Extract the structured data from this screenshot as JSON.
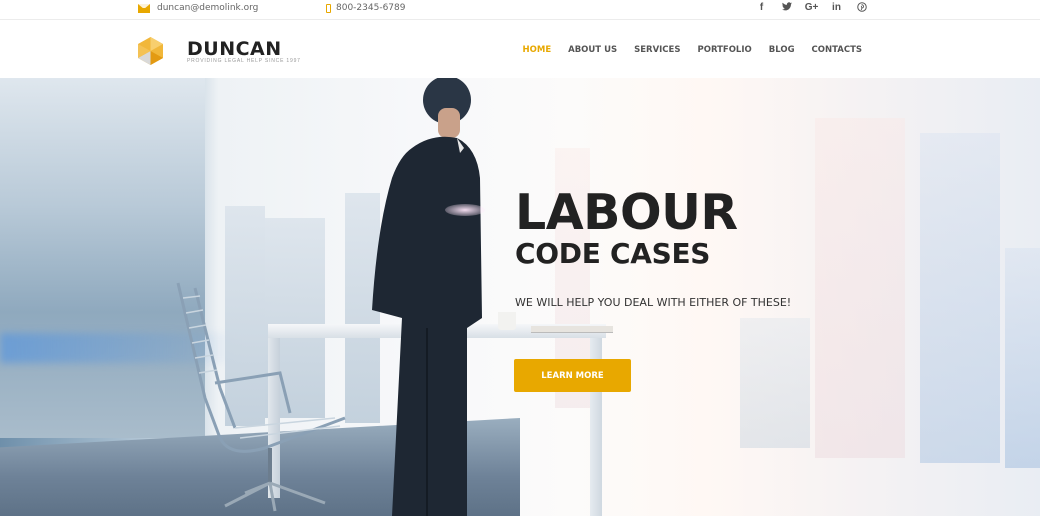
{
  "topbar": {
    "email": "duncan@demolink.org",
    "phone": "800-2345-6789",
    "social": [
      {
        "name": "facebook",
        "glyph": "f"
      },
      {
        "name": "twitter",
        "glyph": "t"
      },
      {
        "name": "google-plus",
        "glyph": "G+"
      },
      {
        "name": "linkedin",
        "glyph": "in"
      },
      {
        "name": "pinterest",
        "glyph": "℗"
      }
    ]
  },
  "header": {
    "brand": "DUNCAN",
    "tagline": "Providing legal help since 1997",
    "nav": [
      {
        "label": "HOME",
        "active": true
      },
      {
        "label": "ABOUT US",
        "active": false
      },
      {
        "label": "SERVICES",
        "active": false
      },
      {
        "label": "PORTFOLIO",
        "active": false
      },
      {
        "label": "BLOG",
        "active": false
      },
      {
        "label": "CONTACTS",
        "active": false
      }
    ]
  },
  "hero": {
    "title": "LABOUR",
    "subtitle": "CODE CASES",
    "tagline": "WE WILL HELP YOU DEAL WITH EITHER OF THESE!",
    "cta_label": "LEARN MORE"
  },
  "colors": {
    "accent": "#e8a800",
    "text_dark": "#222222",
    "nav_text": "#555555"
  }
}
